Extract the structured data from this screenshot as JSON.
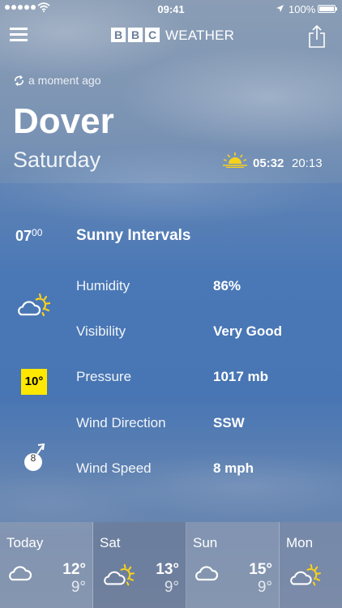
{
  "status_bar": {
    "time": "09:41",
    "battery": "100%"
  },
  "nav": {
    "logo_letters": [
      "B",
      "B",
      "C"
    ],
    "app_name": "WEATHER"
  },
  "header": {
    "refresh_text": "a moment ago",
    "city": "Dover",
    "day": "Saturday",
    "sunrise": "05:32",
    "sunset": "20:13"
  },
  "detail": {
    "hour": "07",
    "minutes": "00",
    "summary": "Sunny Intervals",
    "temperature": "10°",
    "wind_speed_badge": "8",
    "rows": [
      {
        "label": "Humidity",
        "value": "86%"
      },
      {
        "label": "Visibility",
        "value": "Very Good"
      },
      {
        "label": "Pressure",
        "value": "1017 mb"
      },
      {
        "label": "Wind Direction",
        "value": "SSW"
      },
      {
        "label": "Wind Speed",
        "value": "8 mph"
      }
    ]
  },
  "forecast": [
    {
      "day": "Today",
      "high": "12°",
      "low": "9°",
      "icon": "cloud-icon"
    },
    {
      "day": "Sat",
      "high": "13°",
      "low": "9°",
      "icon": "sun-cloud-icon"
    },
    {
      "day": "Sun",
      "high": "15°",
      "low": "9°",
      "icon": "cloud-icon"
    },
    {
      "day": "Mon",
      "high": "",
      "low": "",
      "icon": "sun-cloud-icon"
    }
  ],
  "colors": {
    "temp_badge": "#ffe800",
    "sun": "#f7d21c"
  }
}
